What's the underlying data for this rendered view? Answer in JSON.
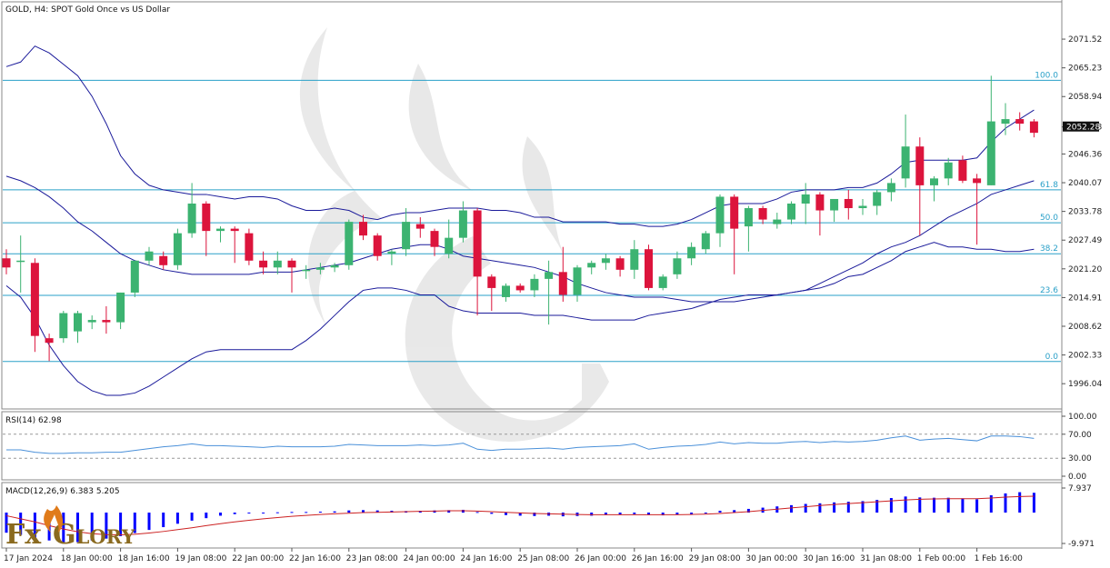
{
  "header": {
    "title": "GOLD, H4:  SPOT Gold Once vs US Dollar"
  },
  "colors": {
    "bull": "#3cb371",
    "bear": "#dc143c",
    "band": "#1a1a9a",
    "fib": "#2aa0c8",
    "rsi": "#4a90d9",
    "macd_hist": "#0000ff",
    "macd_signal": "#cc2222"
  },
  "chart_data": [
    {
      "type": "candlestick",
      "title": "GOLD, H4:  SPOT Gold Once vs US Dollar",
      "y_ticks": [
        "2071.52",
        "2065.23",
        "2058.94",
        "2052.28",
        "2046.36",
        "2040.07",
        "2033.78",
        "2027.49",
        "2021.20",
        "2014.91",
        "2008.62",
        "2002.33",
        "1996.04"
      ],
      "ylim": [
        1991.5,
        2078.5
      ],
      "current_price": "2052.28",
      "fib_levels": [
        {
          "label": "100.0",
          "value": 2062.5
        },
        {
          "label": "61.8",
          "value": 2038.5
        },
        {
          "label": "50.0",
          "value": 2031.3
        },
        {
          "label": "38.2",
          "value": 2024.5
        },
        {
          "label": "23.6",
          "value": 2015.4
        },
        {
          "label": "0.0",
          "value": 2000.9
        }
      ],
      "x_labels": [
        "17 Jan 2024",
        "18 Jan 00:00",
        "18 Jan 16:00",
        "19 Jan 08:00",
        "22 Jan 00:00",
        "22 Jan 16:00",
        "23 Jan 08:00",
        "24 Jan 00:00",
        "24 Jan 16:00",
        "25 Jan 08:00",
        "26 Jan 00:00",
        "26 Jan 16:00",
        "29 Jan 08:00",
        "30 Jan 00:00",
        "30 Jan 16:00",
        "31 Jan 08:00",
        "1 Feb 00:00",
        "1 Feb 16:00"
      ],
      "candles": [
        {
          "o": 2023.5,
          "h": 2025.5,
          "l": 2020.0,
          "c": 2021.5
        },
        {
          "o": 2023.0,
          "h": 2028.5,
          "l": 2016.0,
          "c": 2023.0
        },
        {
          "o": 2022.5,
          "h": 2023.5,
          "l": 2003.0,
          "c": 2006.5
        },
        {
          "o": 2006.0,
          "h": 2007.0,
          "l": 2001.0,
          "c": 2005.0
        },
        {
          "o": 2006.0,
          "h": 2012.0,
          "l": 2005.0,
          "c": 2011.5
        },
        {
          "o": 2007.5,
          "h": 2012.0,
          "l": 2005.0,
          "c": 2011.5
        },
        {
          "o": 2009.5,
          "h": 2011.0,
          "l": 2008.0,
          "c": 2010.0
        },
        {
          "o": 2010.0,
          "h": 2013.0,
          "l": 2007.0,
          "c": 2009.5
        },
        {
          "o": 2009.5,
          "h": 2016.0,
          "l": 2008.0,
          "c": 2016.0
        },
        {
          "o": 2016.0,
          "h": 2023.0,
          "l": 2015.0,
          "c": 2023.0
        },
        {
          "o": 2023.0,
          "h": 2026.0,
          "l": 2022.0,
          "c": 2025.0
        },
        {
          "o": 2024.0,
          "h": 2025.0,
          "l": 2021.0,
          "c": 2022.0
        },
        {
          "o": 2022.0,
          "h": 2030.0,
          "l": 2021.0,
          "c": 2029.0
        },
        {
          "o": 2029.0,
          "h": 2040.0,
          "l": 2028.0,
          "c": 2035.5
        },
        {
          "o": 2035.5,
          "h": 2036.0,
          "l": 2024.0,
          "c": 2029.5
        },
        {
          "o": 2029.5,
          "h": 2030.5,
          "l": 2027.0,
          "c": 2030.0
        },
        {
          "o": 2030.0,
          "h": 2030.5,
          "l": 2022.5,
          "c": 2029.5
        },
        {
          "o": 2029.0,
          "h": 2030.0,
          "l": 2022.0,
          "c": 2023.0
        },
        {
          "o": 2023.0,
          "h": 2025.0,
          "l": 2020.0,
          "c": 2021.5
        },
        {
          "o": 2021.5,
          "h": 2025.0,
          "l": 2020.0,
          "c": 2023.0
        },
        {
          "o": 2023.0,
          "h": 2023.5,
          "l": 2016.0,
          "c": 2021.5
        },
        {
          "o": 2021.0,
          "h": 2022.0,
          "l": 2019.0,
          "c": 2021.0
        },
        {
          "o": 2021.0,
          "h": 2022.5,
          "l": 2020.0,
          "c": 2021.5
        },
        {
          "o": 2021.5,
          "h": 2022.5,
          "l": 2020.5,
          "c": 2022.0
        },
        {
          "o": 2022.0,
          "h": 2032.0,
          "l": 2021.0,
          "c": 2031.5
        },
        {
          "o": 2031.5,
          "h": 2033.0,
          "l": 2027.5,
          "c": 2028.5
        },
        {
          "o": 2028.5,
          "h": 2029.0,
          "l": 2023.0,
          "c": 2024.0
        },
        {
          "o": 2024.5,
          "h": 2025.5,
          "l": 2022.0,
          "c": 2025.0
        },
        {
          "o": 2025.5,
          "h": 2034.5,
          "l": 2024.0,
          "c": 2031.5
        },
        {
          "o": 2031.0,
          "h": 2032.5,
          "l": 2028.0,
          "c": 2030.0
        },
        {
          "o": 2029.5,
          "h": 2030.0,
          "l": 2024.0,
          "c": 2026.0
        },
        {
          "o": 2024.5,
          "h": 2032.0,
          "l": 2023.5,
          "c": 2028.0
        },
        {
          "o": 2028.0,
          "h": 2036.0,
          "l": 2027.0,
          "c": 2034.0
        },
        {
          "o": 2034.0,
          "h": 2034.5,
          "l": 2011.0,
          "c": 2019.5
        },
        {
          "o": 2019.5,
          "h": 2020.0,
          "l": 2012.0,
          "c": 2017.0
        },
        {
          "o": 2015.0,
          "h": 2018.0,
          "l": 2014.0,
          "c": 2017.5
        },
        {
          "o": 2017.5,
          "h": 2018.0,
          "l": 2016.0,
          "c": 2016.5
        },
        {
          "o": 2016.5,
          "h": 2020.0,
          "l": 2015.0,
          "c": 2019.0
        },
        {
          "o": 2019.0,
          "h": 2023.0,
          "l": 2009.0,
          "c": 2020.5
        },
        {
          "o": 2020.5,
          "h": 2026.0,
          "l": 2014.0,
          "c": 2015.5
        },
        {
          "o": 2015.5,
          "h": 2022.0,
          "l": 2014.0,
          "c": 2021.5
        },
        {
          "o": 2021.5,
          "h": 2023.0,
          "l": 2020.0,
          "c": 2022.5
        },
        {
          "o": 2022.5,
          "h": 2024.5,
          "l": 2021.0,
          "c": 2023.5
        },
        {
          "o": 2023.5,
          "h": 2024.0,
          "l": 2019.5,
          "c": 2021.0
        },
        {
          "o": 2021.0,
          "h": 2027.5,
          "l": 2019.0,
          "c": 2025.5
        },
        {
          "o": 2025.5,
          "h": 2026.5,
          "l": 2016.5,
          "c": 2017.0
        },
        {
          "o": 2017.0,
          "h": 2020.0,
          "l": 2016.5,
          "c": 2019.5
        },
        {
          "o": 2020.0,
          "h": 2025.0,
          "l": 2019.0,
          "c": 2023.5
        },
        {
          "o": 2023.5,
          "h": 2027.0,
          "l": 2022.0,
          "c": 2026.0
        },
        {
          "o": 2025.5,
          "h": 2029.5,
          "l": 2024.5,
          "c": 2029.0
        },
        {
          "o": 2029.0,
          "h": 2037.5,
          "l": 2026.0,
          "c": 2037.0
        },
        {
          "o": 2037.0,
          "h": 2037.5,
          "l": 2020.0,
          "c": 2030.0
        },
        {
          "o": 2030.5,
          "h": 2035.0,
          "l": 2025.0,
          "c": 2034.5
        },
        {
          "o": 2034.5,
          "h": 2035.0,
          "l": 2031.0,
          "c": 2032.0
        },
        {
          "o": 2031.0,
          "h": 2033.5,
          "l": 2030.0,
          "c": 2032.0
        },
        {
          "o": 2032.0,
          "h": 2036.0,
          "l": 2031.0,
          "c": 2035.5
        },
        {
          "o": 2035.5,
          "h": 2040.0,
          "l": 2031.0,
          "c": 2037.5
        },
        {
          "o": 2037.5,
          "h": 2038.0,
          "l": 2028.5,
          "c": 2034.0
        },
        {
          "o": 2034.0,
          "h": 2035.5,
          "l": 2031.5,
          "c": 2036.5
        },
        {
          "o": 2036.5,
          "h": 2038.5,
          "l": 2032.0,
          "c": 2034.5
        },
        {
          "o": 2034.5,
          "h": 2036.5,
          "l": 2033.0,
          "c": 2035.0
        },
        {
          "o": 2035.0,
          "h": 2038.5,
          "l": 2033.0,
          "c": 2038.0
        },
        {
          "o": 2038.0,
          "h": 2041.0,
          "l": 2036.0,
          "c": 2040.0
        },
        {
          "o": 2041.0,
          "h": 2055.0,
          "l": 2039.0,
          "c": 2048.0
        },
        {
          "o": 2048.0,
          "h": 2050.0,
          "l": 2028.5,
          "c": 2039.5
        },
        {
          "o": 2039.5,
          "h": 2041.5,
          "l": 2036.0,
          "c": 2041.0
        },
        {
          "o": 2041.0,
          "h": 2045.5,
          "l": 2039.5,
          "c": 2044.5
        },
        {
          "o": 2045.0,
          "h": 2046.0,
          "l": 2040.0,
          "c": 2040.5
        },
        {
          "o": 2041.0,
          "h": 2042.0,
          "l": 2026.5,
          "c": 2040.0
        },
        {
          "o": 2039.5,
          "h": 2063.5,
          "l": 2039.5,
          "c": 2053.5
        },
        {
          "o": 2053.0,
          "h": 2057.5,
          "l": 2050.5,
          "c": 2054.0
        },
        {
          "o": 2054.0,
          "h": 2055.5,
          "l": 2051.5,
          "c": 2053.0
        },
        {
          "o": 2053.5,
          "h": 2054.0,
          "l": 2050.0,
          "c": 2051.0
        }
      ],
      "bollinger_upper": [
        2065.5,
        2066.5,
        2070.0,
        2068.5,
        2066.0,
        2063.5,
        2059.0,
        2053.0,
        2046.0,
        2042.0,
        2039.5,
        2038.5,
        2038.0,
        2037.5,
        2037.5,
        2037.0,
        2036.5,
        2037.0,
        2037.0,
        2036.5,
        2035.0,
        2034.0,
        2034.0,
        2034.5,
        2034.0,
        2032.5,
        2032.0,
        2033.0,
        2033.5,
        2033.5,
        2034.0,
        2034.5,
        2034.5,
        2034.5,
        2034.0,
        2034.0,
        2033.5,
        2032.5,
        2032.5,
        2031.5,
        2031.5,
        2031.5,
        2031.5,
        2031.0,
        2031.0,
        2030.5,
        2030.5,
        2031.0,
        2032.0,
        2033.5,
        2035.0,
        2035.5,
        2035.5,
        2035.5,
        2036.5,
        2038.0,
        2038.5,
        2038.5,
        2038.5,
        2039.0,
        2039.0,
        2040.0,
        2042.0,
        2044.5,
        2045.0,
        2045.0,
        2045.0,
        2045.0,
        2045.5,
        2049.0,
        2052.0,
        2054.0,
        2056.0
      ],
      "bollinger_middle": [
        2041.5,
        2040.5,
        2039.0,
        2037.0,
        2034.5,
        2031.5,
        2029.5,
        2027.0,
        2024.5,
        2023.0,
        2022.0,
        2021.0,
        2020.5,
        2020.0,
        2020.0,
        2020.0,
        2020.0,
        2020.0,
        2020.5,
        2020.5,
        2020.5,
        2021.0,
        2021.5,
        2022.0,
        2022.5,
        2023.5,
        2024.5,
        2025.5,
        2026.0,
        2026.5,
        2026.5,
        2025.5,
        2024.0,
        2023.5,
        2023.0,
        2022.5,
        2022.0,
        2021.5,
        2020.5,
        2019.5,
        2018.0,
        2017.0,
        2016.0,
        2015.5,
        2015.0,
        2015.0,
        2015.0,
        2014.5,
        2014.0,
        2014.0,
        2014.0,
        2014.0,
        2014.5,
        2015.0,
        2015.5,
        2016.0,
        2016.5,
        2018.0,
        2019.5,
        2021.0,
        2022.5,
        2024.5,
        2026.0,
        2027.0,
        2028.5,
        2030.5,
        2032.5,
        2034.0,
        2035.5,
        2037.5,
        2038.5,
        2039.5,
        2040.5
      ],
      "bollinger_lower": [
        2017.5,
        2015.0,
        2010.5,
        2004.5,
        2000.0,
        1996.5,
        1994.5,
        1993.5,
        1993.5,
        1994.0,
        1995.5,
        1997.5,
        1999.5,
        2001.5,
        2003.0,
        2003.5,
        2003.5,
        2003.5,
        2003.5,
        2003.5,
        2003.5,
        2005.5,
        2008.0,
        2011.0,
        2014.0,
        2016.5,
        2017.0,
        2017.0,
        2016.5,
        2015.5,
        2015.5,
        2013.0,
        2012.0,
        2011.5,
        2011.5,
        2011.5,
        2011.5,
        2011.0,
        2011.0,
        2011.0,
        2010.5,
        2010.0,
        2010.0,
        2010.0,
        2010.0,
        2011.0,
        2011.5,
        2012.0,
        2012.5,
        2013.5,
        2014.5,
        2015.0,
        2015.5,
        2015.5,
        2015.5,
        2016.0,
        2016.5,
        2017.0,
        2018.0,
        2019.5,
        2020.0,
        2021.5,
        2023.0,
        2025.0,
        2026.0,
        2027.0,
        2026.0,
        2026.0,
        2025.5,
        2025.5,
        2025.0,
        2025.0,
        2025.5
      ]
    },
    {
      "type": "line",
      "title": "RSI(14) 62.98",
      "y_ticks": [
        "100.00",
        "70.00",
        "30.00",
        "0.00"
      ],
      "ylim": [
        0,
        100
      ],
      "values": [
        44,
        44,
        40,
        38,
        38,
        39,
        39,
        40,
        40,
        43,
        46,
        49,
        51,
        54,
        51,
        51,
        50,
        49,
        48,
        50,
        49,
        49,
        49,
        50,
        53,
        52,
        51,
        51,
        51,
        52,
        51,
        52,
        55,
        45,
        43,
        45,
        45,
        46,
        47,
        45,
        48,
        49,
        50,
        51,
        54,
        45,
        48,
        50,
        51,
        53,
        57,
        54,
        56,
        55,
        55,
        57,
        58,
        56,
        58,
        57,
        58,
        60,
        64,
        67,
        60,
        62,
        63,
        61,
        59,
        67,
        67,
        66,
        63
      ]
    },
    {
      "type": "bar",
      "title": "MACD(12,26,9) 6.383 5.205",
      "y_ticks": [
        "7.937",
        "-9.971"
      ],
      "ylim": [
        -9.971,
        7.937
      ],
      "histogram": [
        -6.5,
        -7.2,
        -8.2,
        -9.0,
        -9.6,
        -9.5,
        -9.0,
        -8.4,
        -7.6,
        -6.6,
        -5.6,
        -4.7,
        -3.6,
        -2.6,
        -1.8,
        -1.0,
        -0.5,
        -0.2,
        0.0,
        0.1,
        0.2,
        0.2,
        0.3,
        0.4,
        0.7,
        0.8,
        0.7,
        0.6,
        0.5,
        0.6,
        0.7,
        0.8,
        0.9,
        0.2,
        -0.4,
        -0.8,
        -1.0,
        -1.1,
        -1.0,
        -1.2,
        -1.1,
        -1.0,
        -0.8,
        -0.7,
        -0.5,
        -0.8,
        -0.9,
        -0.7,
        -0.5,
        -0.2,
        0.6,
        0.8,
        1.2,
        1.6,
        2.0,
        2.4,
        2.8,
        3.0,
        3.3,
        3.5,
        3.7,
        4.1,
        4.7,
        5.2,
        4.9,
        4.8,
        4.8,
        4.6,
        4.3,
        5.6,
        6.2,
        6.6,
        6.4
      ],
      "signal": [
        -1.0,
        -2.0,
        -3.0,
        -4.2,
        -5.3,
        -6.2,
        -6.8,
        -7.1,
        -7.2,
        -7.0,
        -6.6,
        -6.1,
        -5.5,
        -4.9,
        -4.2,
        -3.6,
        -3.0,
        -2.5,
        -2.0,
        -1.6,
        -1.2,
        -0.9,
        -0.6,
        -0.4,
        -0.2,
        0.0,
        0.1,
        0.2,
        0.3,
        0.4,
        0.5,
        0.6,
        0.6,
        0.5,
        0.3,
        0.1,
        -0.1,
        -0.3,
        -0.4,
        -0.5,
        -0.6,
        -0.7,
        -0.7,
        -0.7,
        -0.7,
        -0.7,
        -0.7,
        -0.7,
        -0.6,
        -0.5,
        -0.3,
        0.0,
        0.3,
        0.7,
        1.1,
        1.5,
        1.9,
        2.3,
        2.6,
        2.9,
        3.2,
        3.5,
        3.8,
        4.1,
        4.3,
        4.4,
        4.5,
        4.5,
        4.5,
        4.7,
        5.0,
        5.2,
        5.3
      ]
    }
  ],
  "logo": {
    "part1": "Fx",
    "part2": "Glory"
  }
}
